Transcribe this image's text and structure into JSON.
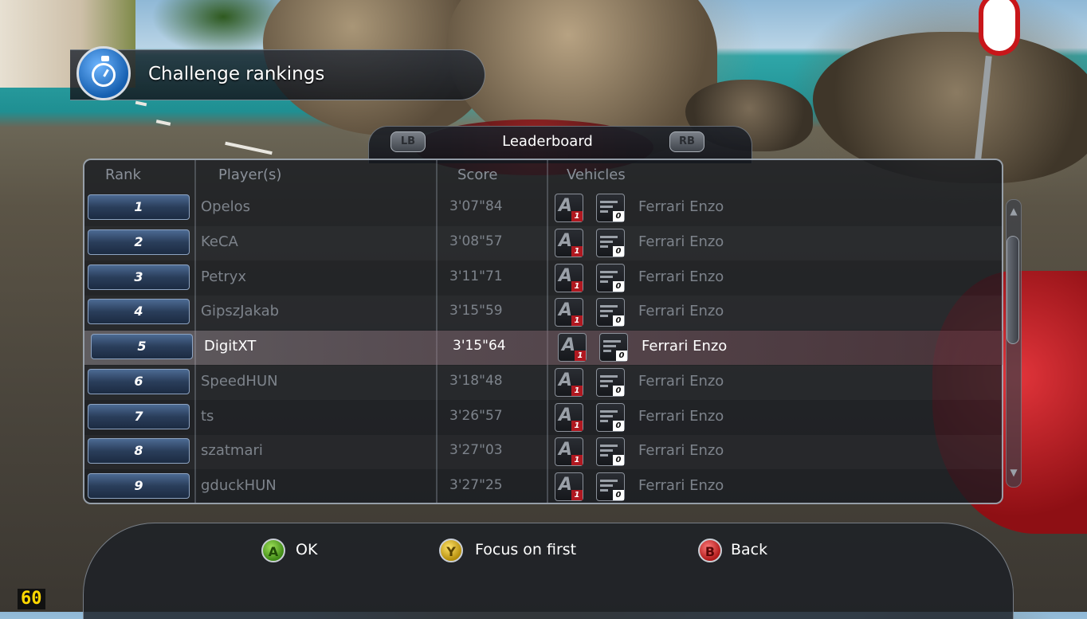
{
  "header": {
    "title": "Challenge rankings",
    "icon": "stopwatch-icon"
  },
  "leaderboard": {
    "title": "Leaderboard",
    "left_bumper": "LB",
    "right_bumper": "RB"
  },
  "columns": {
    "rank": "Rank",
    "players": "Player(s)",
    "score": "Score",
    "vehicles": "Vehicles"
  },
  "rows": [
    {
      "rank": "1",
      "player": "Opelos",
      "score": "3'07\"84",
      "class": "A",
      "class_num": "1",
      "count": "0",
      "vehicle": "Ferrari Enzo"
    },
    {
      "rank": "2",
      "player": "KeCA",
      "score": "3'08\"57",
      "class": "A",
      "class_num": "1",
      "count": "0",
      "vehicle": "Ferrari Enzo"
    },
    {
      "rank": "3",
      "player": "Petryx",
      "score": "3'11\"71",
      "class": "A",
      "class_num": "1",
      "count": "0",
      "vehicle": "Ferrari Enzo"
    },
    {
      "rank": "4",
      "player": "GipszJakab",
      "score": "3'15\"59",
      "class": "A",
      "class_num": "1",
      "count": "0",
      "vehicle": "Ferrari Enzo"
    },
    {
      "rank": "5",
      "player": "DigitXT",
      "score": "3'15\"64",
      "class": "A",
      "class_num": "1",
      "count": "0",
      "vehicle": "Ferrari Enzo",
      "selected": true
    },
    {
      "rank": "6",
      "player": "SpeedHUN",
      "score": "3'18\"48",
      "class": "A",
      "class_num": "1",
      "count": "0",
      "vehicle": "Ferrari Enzo"
    },
    {
      "rank": "7",
      "player": "ts",
      "score": "3'26\"57",
      "class": "A",
      "class_num": "1",
      "count": "0",
      "vehicle": "Ferrari Enzo"
    },
    {
      "rank": "8",
      "player": "szatmari",
      "score": "3'27\"03",
      "class": "A",
      "class_num": "1",
      "count": "0",
      "vehicle": "Ferrari Enzo"
    },
    {
      "rank": "9",
      "player": "gduckHUN",
      "score": "3'27\"25",
      "class": "A",
      "class_num": "1",
      "count": "0",
      "vehicle": "Ferrari Enzo"
    }
  ],
  "footer": {
    "ok": {
      "button": "A",
      "label": "OK"
    },
    "focus": {
      "button": "Y",
      "label": "Focus on first"
    },
    "back": {
      "button": "B",
      "label": "Back"
    }
  },
  "fps": "60",
  "colors": {
    "highlight": "#b98c96",
    "rank_button": "#2a3e5b",
    "fps": "#ffd800"
  }
}
